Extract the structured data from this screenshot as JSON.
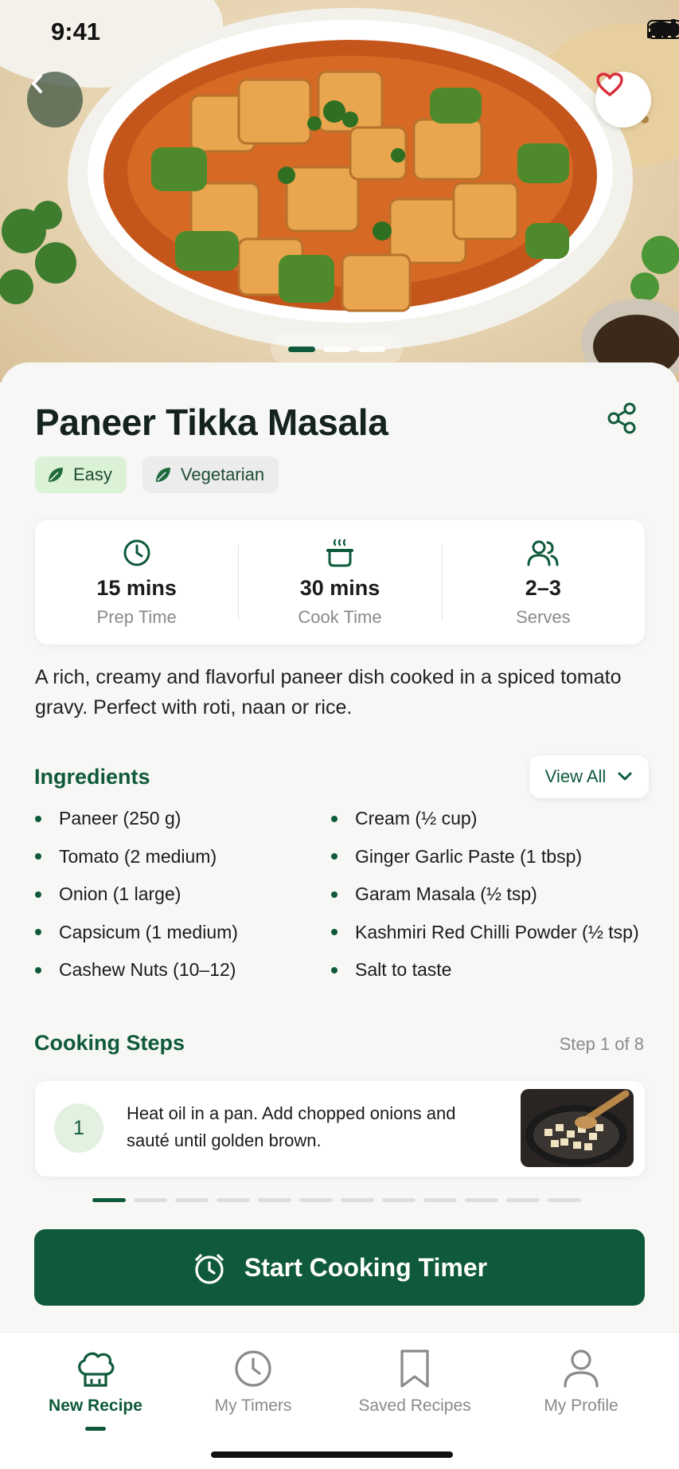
{
  "status_bar": {
    "time": "9:41"
  },
  "recipe": {
    "title": "Paneer Tikka Masala",
    "tags": [
      "Easy",
      "Vegetarian"
    ],
    "stats": [
      {
        "icon": "clock-icon",
        "value": "15 mins",
        "label": "Prep Time"
      },
      {
        "icon": "pot-icon",
        "value": "30 mins",
        "label": "Cook Time"
      },
      {
        "icon": "users-icon",
        "value": "2–3",
        "label": "Serves"
      }
    ],
    "description": "A rich, creamy and flavorful paneer dish cooked in a spiced tomato gravy. Perfect with roti, naan or rice."
  },
  "hero": {
    "image_count": 3,
    "active_index": 0
  },
  "ingredients": {
    "title": "Ingredients",
    "view_all_label": "View All",
    "left": [
      "Paneer (250 g)",
      "Tomato (2 medium)",
      "Onion (1 large)",
      "Capsicum (1 medium)",
      "Cashew Nuts (10–12)"
    ],
    "right": [
      "Cream (½ cup)",
      "Ginger Garlic Paste (1 tbsp)",
      "Garam Masala (½ tsp)",
      "Kashmiri Red Chilli Powder (½ tsp)",
      "Salt to taste"
    ]
  },
  "steps": {
    "title": "Cooking Steps",
    "counter": "Step 1 of 8",
    "current": {
      "number": "1",
      "text": "Heat oil in a pan. Add chopped onions and sauté until golden brown."
    },
    "progress_segments": 12,
    "progress_active": 1
  },
  "cta": {
    "label": "Start Cooking Timer"
  },
  "tabbar": {
    "tabs": [
      {
        "label": "New Recipe",
        "icon": "chef-hat-icon",
        "active": true
      },
      {
        "label": "My Timers",
        "icon": "clock-icon",
        "active": false
      },
      {
        "label": "Saved Recipes",
        "icon": "bookmark-icon",
        "active": false
      },
      {
        "label": "My Profile",
        "icon": "profile-icon",
        "active": false
      }
    ]
  },
  "colors": {
    "primary": "#0f5a3a",
    "easy_tag_bg": "#dcf2d6",
    "heart": "#d92c3a"
  }
}
